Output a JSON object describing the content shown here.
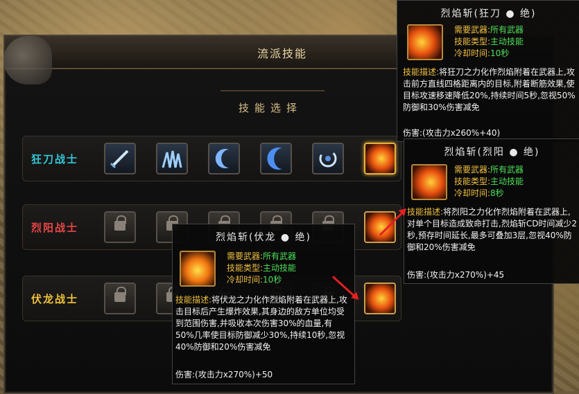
{
  "panel": {
    "title": "流派技能",
    "subtitle": "技能选择"
  },
  "rows": [
    {
      "label": "狂刀战士",
      "color": "#32c7d8",
      "skills": [
        "blade-icon",
        "wave-icon",
        "crescent-icon",
        "crescent-blue-icon",
        "swirl-icon",
        "flame-slash-icon"
      ]
    },
    {
      "label": "烈阳战士",
      "color": "#e84545",
      "skills": [
        "lock-icon",
        "lock-icon",
        "lock-icon",
        "lock-icon",
        "lock-icon",
        "flame-sun-icon"
      ]
    },
    {
      "label": "伏龙战士",
      "color": "#f0c23a",
      "skills": [
        "lock-icon",
        "lock-icon",
        "lock-icon",
        "lock-icon",
        "lock-icon",
        "flame-dragon-icon"
      ]
    }
  ],
  "tooltips": [
    {
      "title": "烈焰斩(狂刀 ● 绝)",
      "weapon_label": "需要武器:",
      "weapon": "所有武器",
      "type_label": "技能类型:",
      "type": "主动技能",
      "cd_label": "冷却时间:",
      "cd": "10秒",
      "desc_label": "技能描述:",
      "desc": "将狂刀之力化作烈焰附着在武器上,攻击前方直线四格距离内的目标,附着断筋效果,使目标攻速移速降低20%,持续时间5秒,忽视50%防御和30%伤害减免",
      "damage": "伤害:(攻击力x260%+40)"
    },
    {
      "title": "烈焰斩(烈阳 ● 绝)",
      "weapon_label": "需要武器:",
      "weapon": "所有武器",
      "type_label": "技能类型:",
      "type": "主动技能",
      "cd_label": "冷却时间:",
      "cd": "8秒",
      "desc_label": "技能描述:",
      "desc": "将烈阳之力化作烈焰附着在武器上,对单个目标造成致命打击,烈焰斩CD时间减少2秒,预存时间延长,最多可叠加3层,忽视40%防御和20%伤害减免",
      "damage": "伤害:(攻击力x270%)+45"
    },
    {
      "title": "烈焰斩(伏龙 ● 绝)",
      "weapon_label": "需要武器:",
      "weapon": "所有武器",
      "type_label": "技能类型:",
      "type": "主动技能",
      "cd_label": "冷却时间:",
      "cd": "10秒",
      "desc_label": "技能描述:",
      "desc": "将伏龙之力化作烈焰附着在武器上,攻击目标后产生爆炸效果,其身边的敌方单位均受到范围伤害,并吸收本次伤害30%的血量,有50%几率使目标防御减少30%,持续10秒,忽视40%防御和20%伤害减免",
      "damage": "伤害:(攻击力x270%)+50"
    }
  ]
}
